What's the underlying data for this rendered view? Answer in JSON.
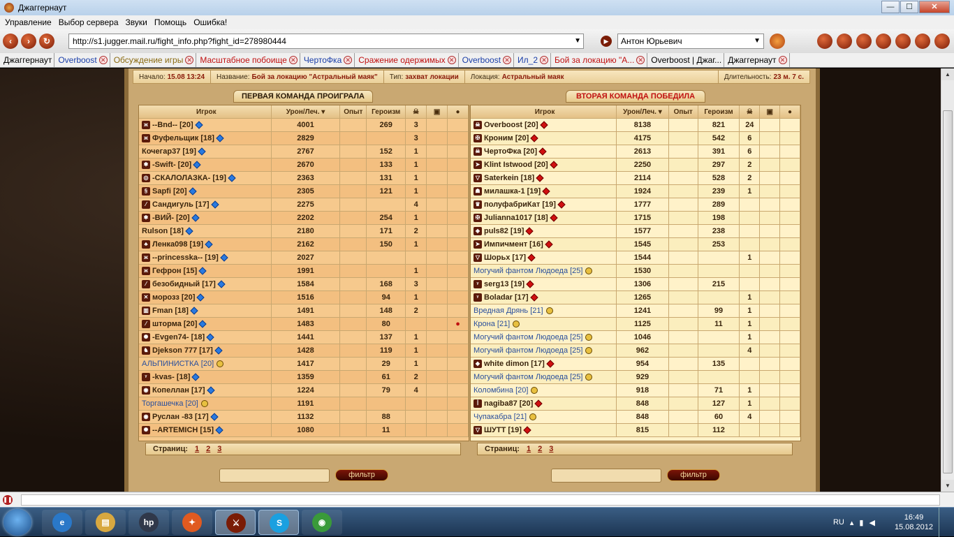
{
  "window": {
    "title": "Джаггернаут",
    "min": "—",
    "max": "☐",
    "close": "✕"
  },
  "menu": [
    "Управление",
    "Выбор сервера",
    "Звуки",
    "Помощь",
    "Ошибка!"
  ],
  "nav": {
    "url": "http://s1.jugger.mail.ru/fight_info.php?fight_id=278980444",
    "user": "Антон Юрьевич"
  },
  "tabs": [
    {
      "label": "Джаггернаут",
      "color": "#000000",
      "close": false
    },
    {
      "label": "Overboost",
      "color": "#1a3ea8",
      "close": true
    },
    {
      "label": "Обсуждение игры",
      "color": "#8a6a10",
      "close": true
    },
    {
      "label": "Масштабное побоище",
      "color": "#c01010",
      "close": true
    },
    {
      "label": "ЧертоФка",
      "color": "#1a3ea8",
      "close": true
    },
    {
      "label": "Сражение одержимых",
      "color": "#c01010",
      "close": true
    },
    {
      "label": "Overboost",
      "color": "#1a3ea8",
      "close": true
    },
    {
      "label": "Ил_2",
      "color": "#1a3ea8",
      "close": true
    },
    {
      "label": "Бой за локацию \"А...",
      "color": "#c01010",
      "close": true
    },
    {
      "label": "Overboost | Джаг...",
      "color": "#000000",
      "close": false
    },
    {
      "label": "Джаггернаут",
      "color": "#000000",
      "close": true
    }
  ],
  "fight": {
    "start_label": "Начало:",
    "start": "15.08 13:24",
    "name_label": "Название:",
    "name": "Бой за локацию \"Астральный маяк\"",
    "type_label": "Тип:",
    "type": "захват локации",
    "loc_label": "Локация:",
    "location": "Астральный маяк",
    "dur_label": "Длительность:",
    "duration": "23 м. 7 с."
  },
  "team1": {
    "header": "ПЕРВАЯ КОМАНДА ПРОИГРАЛА",
    "cols": [
      "Игрок",
      "Урон/Леч. ▾",
      "Опыт",
      "Героизм",
      "☠",
      "▣",
      "●"
    ],
    "rows": [
      [
        "--Bnd-- [20]",
        "4001",
        "",
        "269",
        "3",
        "",
        "",
        false,
        "ж"
      ],
      [
        "Фуфельщик [18]",
        "2829",
        "",
        "",
        "3",
        "",
        "",
        false,
        "ж"
      ],
      [
        "Кочегар37 [19]",
        "2767",
        "",
        "152",
        "1",
        "",
        "",
        false,
        ""
      ],
      [
        "-Swift- [20]",
        "2670",
        "",
        "133",
        "1",
        "",
        "",
        false,
        "✱"
      ],
      [
        "-СКАЛОЛАЗКА- [19]",
        "2363",
        "",
        "131",
        "1",
        "",
        "",
        false,
        "◎"
      ],
      [
        "Sapfi [20]",
        "2305",
        "",
        "121",
        "1",
        "",
        "",
        false,
        "§"
      ],
      [
        "Сандигуль [17]",
        "2275",
        "",
        "",
        "4",
        "",
        "",
        false,
        "⁄"
      ],
      [
        "-ВИЙ- [20]",
        "2202",
        "",
        "254",
        "1",
        "",
        "",
        false,
        "✱"
      ],
      [
        "Rulson [18]",
        "2180",
        "",
        "171",
        "2",
        "",
        "",
        false,
        ""
      ],
      [
        "Ленка098 [19]",
        "2162",
        "",
        "150",
        "1",
        "",
        "",
        false,
        "♣"
      ],
      [
        "--princesska-- [19]",
        "2027",
        "",
        "",
        "",
        "",
        "",
        false,
        "ж"
      ],
      [
        "Гефрон [15]",
        "1991",
        "",
        "",
        "1",
        "",
        "",
        false,
        "ж"
      ],
      [
        "безобидный [17]",
        "1584",
        "",
        "168",
        "3",
        "",
        "",
        false,
        "⁄"
      ],
      [
        "морозз [20]",
        "1516",
        "",
        "94",
        "1",
        "",
        "",
        false,
        "✕"
      ],
      [
        "Fman [18]",
        "1491",
        "",
        "148",
        "2",
        "",
        "",
        false,
        "▥"
      ],
      [
        "шторма [20]",
        "1483",
        "",
        "80",
        "",
        "",
        "●",
        false,
        "⁄"
      ],
      [
        "-Evgen74- [18]",
        "1441",
        "",
        "137",
        "1",
        "",
        "",
        false,
        "✺"
      ],
      [
        "Djekson 777 [17]",
        "1428",
        "",
        "119",
        "1",
        "",
        "",
        false,
        "♞"
      ],
      [
        "АЛЬПИНИСТКА [20]",
        "1417",
        "",
        "29",
        "1",
        "",
        "",
        true,
        ""
      ],
      [
        "-kvas- [18]",
        "1359",
        "",
        "61",
        "2",
        "",
        "",
        false,
        "ᵞ"
      ],
      [
        "Копеллан [17]",
        "1224",
        "",
        "79",
        "4",
        "",
        "",
        false,
        "◉"
      ],
      [
        "Торгашечка [20]",
        "1191",
        "",
        "",
        "",
        "",
        "",
        true,
        ""
      ],
      [
        "Руслан -83 [17]",
        "1132",
        "",
        "88",
        "",
        "",
        "",
        false,
        "◉"
      ],
      [
        "--ARTEMICH [15]",
        "1080",
        "",
        "11",
        "",
        "",
        "",
        false,
        "✺"
      ]
    ],
    "pages_label": "Страниц:",
    "pages": [
      "1",
      "2",
      "3"
    ]
  },
  "team2": {
    "header": "ВТОРАЯ КОМАНДА ПОБЕДИЛА",
    "cols": [
      "Игрок",
      "Урон/Леч. ▾",
      "Опыт",
      "Героизм",
      "☠",
      "▣",
      "●"
    ],
    "rows": [
      [
        "Overboost [20]",
        "8138",
        "",
        "821",
        "24",
        "",
        "",
        false,
        "☠"
      ],
      [
        "Кроним [20]",
        "4175",
        "",
        "542",
        "6",
        "",
        "",
        false,
        "✠"
      ],
      [
        "ЧертоФка [20]",
        "2613",
        "",
        "391",
        "6",
        "",
        "",
        false,
        "☠"
      ],
      [
        "Klint Istwood [20]",
        "2250",
        "",
        "297",
        "2",
        "",
        "",
        false,
        "➤"
      ],
      [
        "Saterkein [18]",
        "2114",
        "",
        "528",
        "2",
        "",
        "",
        false,
        "▽"
      ],
      [
        "милашка-1 [19]",
        "1924",
        "",
        "239",
        "1",
        "",
        "",
        false,
        "☗"
      ],
      [
        "полуфабриКат [19]",
        "1777",
        "",
        "289",
        "",
        "",
        "",
        false,
        "♛"
      ],
      [
        "Julianna1017 [18]",
        "1715",
        "",
        "198",
        "",
        "",
        "",
        false,
        "✠"
      ],
      [
        "puls82 [19]",
        "1577",
        "",
        "238",
        "",
        "",
        "",
        false,
        "◈"
      ],
      [
        "Импичмент [16]",
        "1545",
        "",
        "253",
        "",
        "",
        "",
        false,
        "➤"
      ],
      [
        "Шорьх [17]",
        "1544",
        "",
        "",
        "1",
        "",
        "",
        false,
        "▽"
      ],
      [
        "Могучий фантом Людоеда [25]",
        "1530",
        "",
        "",
        "",
        "",
        "",
        true,
        ""
      ],
      [
        "serg13 [19]",
        "1306",
        "",
        "215",
        "",
        "",
        "",
        false,
        "ᵞ"
      ],
      [
        "Boladar [17]",
        "1265",
        "",
        "",
        "1",
        "",
        "",
        false,
        "ᵞ"
      ],
      [
        "Вредная Дрянь [21]",
        "1241",
        "",
        "99",
        "1",
        "",
        "",
        true,
        ""
      ],
      [
        "Крона [21]",
        "1125",
        "",
        "11",
        "1",
        "",
        "",
        true,
        ""
      ],
      [
        "Могучий фантом Людоеда [25]",
        "1046",
        "",
        "",
        "1",
        "",
        "",
        true,
        ""
      ],
      [
        "Могучий фантом Людоеда [25]",
        "962",
        "",
        "",
        "4",
        "",
        "",
        true,
        ""
      ],
      [
        "white dimon [17]",
        "954",
        "",
        "135",
        "",
        "",
        "",
        false,
        "◆"
      ],
      [
        "Могучий фантом Людоеда [25]",
        "929",
        "",
        "",
        "",
        "",
        "",
        true,
        ""
      ],
      [
        "Коломбина [20]",
        "918",
        "",
        "71",
        "1",
        "",
        "",
        true,
        ""
      ],
      [
        "nagiba87 [20]",
        "848",
        "",
        "127",
        "1",
        "",
        "",
        false,
        "ꟾ"
      ],
      [
        "Чупакабра [21]",
        "848",
        "",
        "60",
        "4",
        "",
        "",
        true,
        ""
      ],
      [
        "ШУТТ [19]",
        "815",
        "",
        "112",
        "",
        "",
        "",
        false,
        "▽"
      ]
    ],
    "pages_label": "Страниц:",
    "pages": [
      "1",
      "2",
      "3"
    ]
  },
  "filter_label": "фильтр",
  "taskbar": {
    "lang": "RU",
    "time": "16:49",
    "date": "15.08.2012",
    "apps": [
      "e",
      "▤",
      "hp",
      "✦",
      "⚔",
      "S",
      "◉"
    ]
  }
}
